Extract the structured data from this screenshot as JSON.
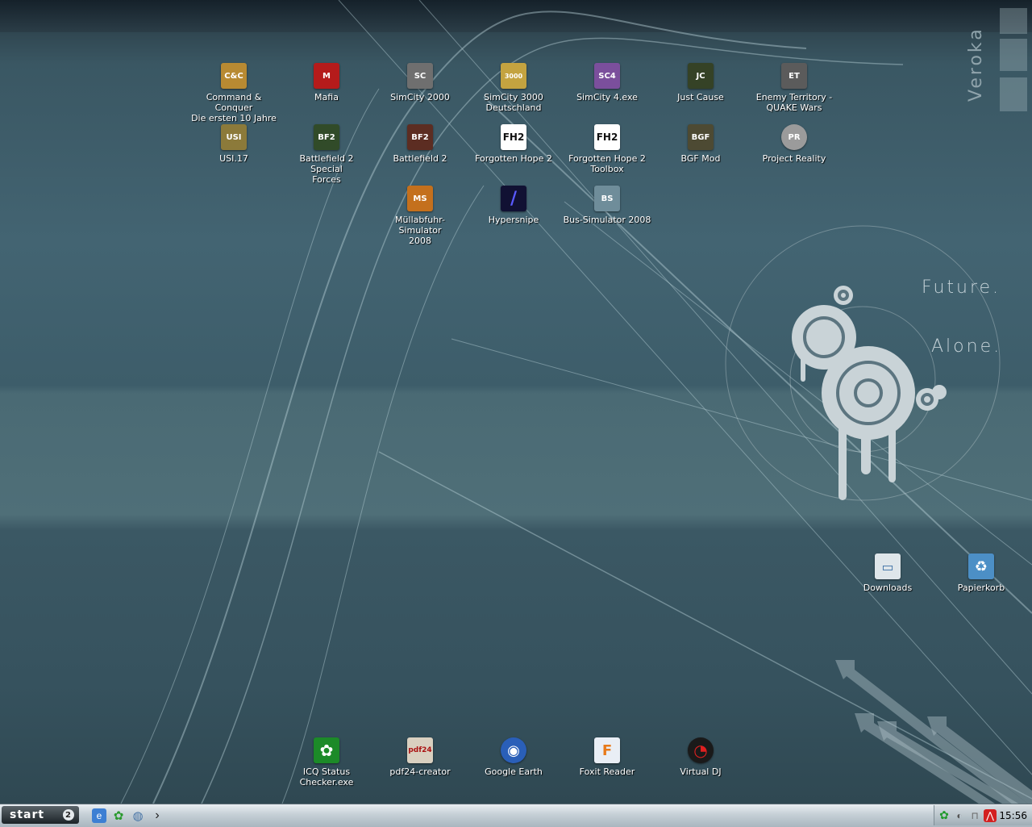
{
  "wallpaper": {
    "future_text": "Future.",
    "alone_text": "Alone.",
    "brand_text": "Veroka"
  },
  "desktop_icons": [
    {
      "name": "command-conquer",
      "label": "Command & Conquer\nDie ersten 10 Jahre",
      "icon": "cc-icon",
      "color": "#b88a32",
      "glyph": "C&C"
    },
    {
      "name": "mafia",
      "label": "Mafia",
      "icon": "mafia-icon",
      "color": "#b51b1b",
      "glyph": "M"
    },
    {
      "name": "simcity-2000",
      "label": "SimCity 2000",
      "icon": "simcity-icon",
      "color": "#6f6f6f",
      "glyph": "SC"
    },
    {
      "name": "simcity-3000",
      "label": "SimCity 3000\nDeutschland",
      "icon": "simcity3000-icon",
      "color": "#c4a340",
      "glyph": "3000"
    },
    {
      "name": "simcity-4",
      "label": "SimCity 4.exe",
      "icon": "simcity4-icon",
      "color": "#7b4f9c",
      "glyph": "SC4"
    },
    {
      "name": "just-cause",
      "label": "Just Cause",
      "icon": "just-cause-icon",
      "color": "#354226",
      "glyph": "JC"
    },
    {
      "name": "enemy-territory",
      "label": "Enemy Territory -\nQUAKE Wars",
      "icon": "etqw-icon",
      "color": "#5b5b5b",
      "glyph": "ET"
    },
    {
      "name": "usi17",
      "label": "USI.17",
      "icon": "usi-icon",
      "color": "#8c7a3a",
      "glyph": "USI"
    },
    {
      "name": "bf2-special-forces",
      "label": "Battlefield 2 Special\nForces",
      "icon": "bf2sf-icon",
      "color": "#314b29",
      "glyph": "BF2"
    },
    {
      "name": "battlefield-2",
      "label": "Battlefield 2",
      "icon": "bf2-icon",
      "color": "#5c2d22",
      "glyph": "BF2"
    },
    {
      "name": "forgotten-hope-2",
      "label": "Forgotten Hope 2",
      "icon": "fh2-icon",
      "color": "#ffffff",
      "glyph": "FH2"
    },
    {
      "name": "fh2-toolbox",
      "label": "Forgotten Hope 2\nToolbox",
      "icon": "fh2-toolbox-icon",
      "color": "#ffffff",
      "glyph": "FH2"
    },
    {
      "name": "bgf-mod",
      "label": "BGF Mod",
      "icon": "bgf-icon",
      "color": "#4d4a33",
      "glyph": "BGF"
    },
    {
      "name": "project-reality",
      "label": "Project Reality",
      "icon": "pr-icon",
      "color": "#9b9b9b",
      "glyph": "PR"
    },
    {
      "name": "muellabfuhr",
      "label": "Müllabfuhr-Simulator\n2008",
      "icon": "garbage-truck-icon",
      "color": "#c4701d",
      "glyph": "MS"
    },
    {
      "name": "hypersnipe",
      "label": "Hypersnipe",
      "icon": "hypersnipe-icon",
      "color": "#111133",
      "glyph": "/"
    },
    {
      "name": "bus-simulator",
      "label": "Bus-Simulator 2008",
      "icon": "bus-icon",
      "color": "#6f8d9a",
      "glyph": "BS"
    },
    {
      "name": "downloads",
      "label": "Downloads",
      "icon": "folder-icon",
      "color": "#dfe6ea",
      "glyph": "▭"
    },
    {
      "name": "papierkorb",
      "label": "Papierkorb",
      "icon": "recycle-bin-icon",
      "color": "#4c8fc6",
      "glyph": "♻"
    },
    {
      "name": "icq-status",
      "label": "ICQ Status\nChecker.exe",
      "icon": "icq-icon",
      "color": "#1c8a28",
      "glyph": "✿"
    },
    {
      "name": "pdf24",
      "label": "pdf24-creator",
      "icon": "pdf24-icon",
      "color": "#d9d0c0",
      "glyph": "pdf24"
    },
    {
      "name": "google-earth",
      "label": "Google Earth",
      "icon": "google-earth-icon",
      "color": "#2a5fb8",
      "glyph": "◉"
    },
    {
      "name": "foxit-reader",
      "label": "Foxit Reader",
      "icon": "foxit-icon",
      "color": "#e9eef5",
      "glyph": "F"
    },
    {
      "name": "virtual-dj",
      "label": "Virtual DJ",
      "icon": "virtual-dj-icon",
      "color": "#1a1a1a",
      "glyph": "◔"
    }
  ],
  "taskbar": {
    "start_label": "start",
    "quicklaunch": [
      {
        "name": "ie-icon",
        "glyph": "e",
        "color": "#3d7fd3"
      },
      {
        "name": "icq-icon",
        "glyph": "✿",
        "color": "#2a9a2e"
      },
      {
        "name": "globe-icon",
        "glyph": "◍",
        "color": "#4a76a8"
      },
      {
        "name": "chevron-right-icon",
        "glyph": "›",
        "color": "transparent"
      }
    ],
    "tray": [
      {
        "name": "icq-tray-icon",
        "glyph": "✿",
        "color": "#1f9a2a"
      },
      {
        "name": "network-tray-icon",
        "glyph": "◐",
        "color": "#6f7c84"
      },
      {
        "name": "safely-remove-tray-icon",
        "glyph": "⊓",
        "color": "#7a7a7a"
      },
      {
        "name": "antivir-tray-icon",
        "glyph": "⋀",
        "color": "#d32020"
      }
    ],
    "clock": "15:56"
  }
}
